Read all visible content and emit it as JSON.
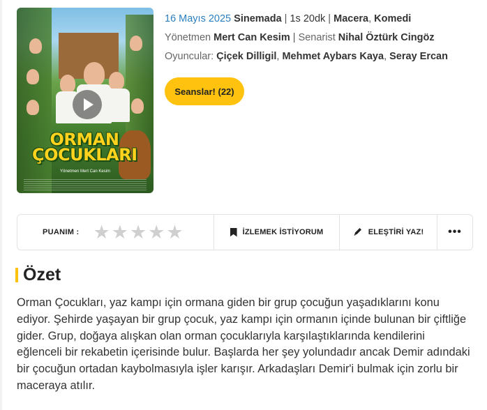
{
  "movie": {
    "poster": {
      "title_line1": "ORMAN",
      "title_line2": "ÇOCUKLARI",
      "director_credit": "Yönetmen Mert Can Kesim"
    },
    "release_date": "16 Mayıs 2025",
    "release_status": "Sinemada",
    "duration": "1s 20dk",
    "genres": [
      "Macera",
      "Komedi"
    ],
    "director_label": "Yönetmen",
    "director": "Mert Can Kesim",
    "writer_label": "Senarist",
    "writer": "Nihal Öztürk Cingöz",
    "cast_label": "Oyuncular:",
    "cast": [
      "Çiçek Dilligil",
      "Mehmet Aybars Kaya",
      "Seray Ercan"
    ],
    "sessions_button": "Seanslar! (22)"
  },
  "actions": {
    "rating_label": "PUANIM :",
    "stars_filled": 0,
    "stars_total": 5,
    "watchlist_label": "İZLEMEK İSTİYORUM",
    "review_label": "ELEŞTİRİ YAZ!",
    "more_label": "•••"
  },
  "summary": {
    "heading": "Özet",
    "text": "Orman Çocukları, yaz kampı için ormana giden bir grup çocuğun yaşadıklarını konu ediyor. Şehirde yaşayan bir grup çocuk, yaz kampı için ormanın içinde bulunan bir çiftliğe gider. Grup, doğaya alışkan olan orman çocuklarıyla karşılaştıklarında kendilerini eğlenceli bir rekabetin içerisinde bulur. Başlarda her şey yolundadır ancak Demir adındaki bir çocuğun ortadan kaybolmasıyla işler karışır. Arkadaşları Demir'i bulmak için zorlu bir maceraya atılır."
  },
  "colors": {
    "accent": "#ffc20e",
    "date_blue": "#2b7fc0",
    "star_empty": "#cfcfcf"
  },
  "icons": {
    "watchlist": "bookmark-icon",
    "review": "pencil-icon",
    "more": "more-dots-icon",
    "trailer": "play-icon",
    "rating": "star-icon"
  }
}
